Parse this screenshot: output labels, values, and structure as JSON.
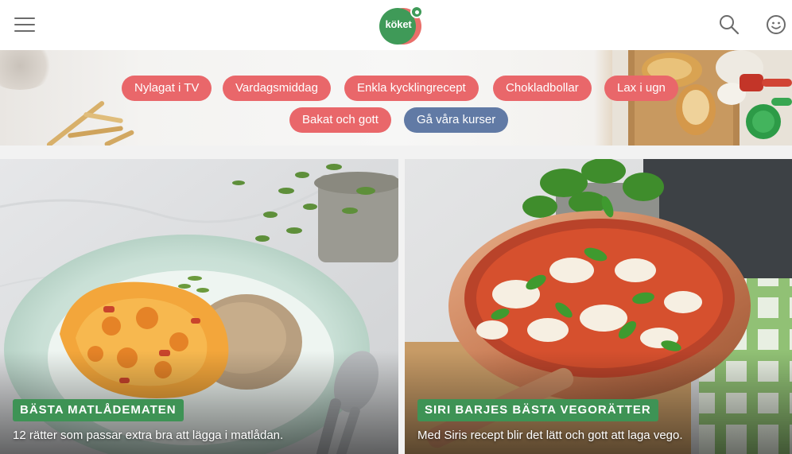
{
  "header": {
    "menu_icon": "hamburger-menu-icon",
    "logo_text": "köket",
    "search_icon": "search-icon",
    "profile_icon": "smiley-profile-icon"
  },
  "tags": [
    {
      "label": "Nylagat i TV",
      "color": "#e9676a"
    },
    {
      "label": "Vardagsmiddag",
      "color": "#e9676a"
    },
    {
      "label": "Enkla kycklingrecept",
      "color": "#e9676a"
    },
    {
      "label": "Chokladbollar",
      "color": "#e9676a"
    },
    {
      "label": "Lax i ugn",
      "color": "#e9676a"
    },
    {
      "label": "Bakat och gott",
      "color": "#e9676a"
    },
    {
      "label": "Gå våra kurser",
      "color": "#617aa5"
    }
  ],
  "cards": [
    {
      "badge": "BÄSTA MATLÅDEMATEN",
      "description": "12 rätter som passar extra bra att lägga i matlådan."
    },
    {
      "badge": "SIRI BARJES BÄSTA VEGORÄTTER",
      "description": "Med Siris recept blir det lätt och gott att laga vego."
    }
  ],
  "colors": {
    "brand_green": "#3e9355",
    "tag_red": "#e9676a",
    "tag_blue": "#617aa5"
  }
}
